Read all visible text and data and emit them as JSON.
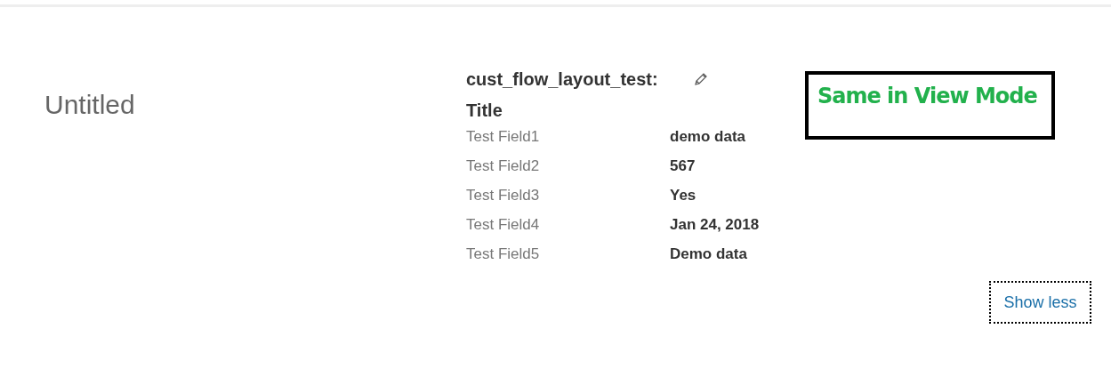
{
  "page_title": "Untitled",
  "record": {
    "name": "cust_flow_layout_test:",
    "section_title": "Title",
    "fields": [
      {
        "label": "Test Field1",
        "value": "demo data"
      },
      {
        "label": "Test Field2",
        "value": "567"
      },
      {
        "label": "Test Field3",
        "value": "Yes"
      },
      {
        "label": "Test Field4",
        "value": "Jan 24, 2018"
      },
      {
        "label": "Test Field5",
        "value": "Demo data"
      }
    ]
  },
  "annotation": "Same in View Mode",
  "show_less_button": "Show less"
}
